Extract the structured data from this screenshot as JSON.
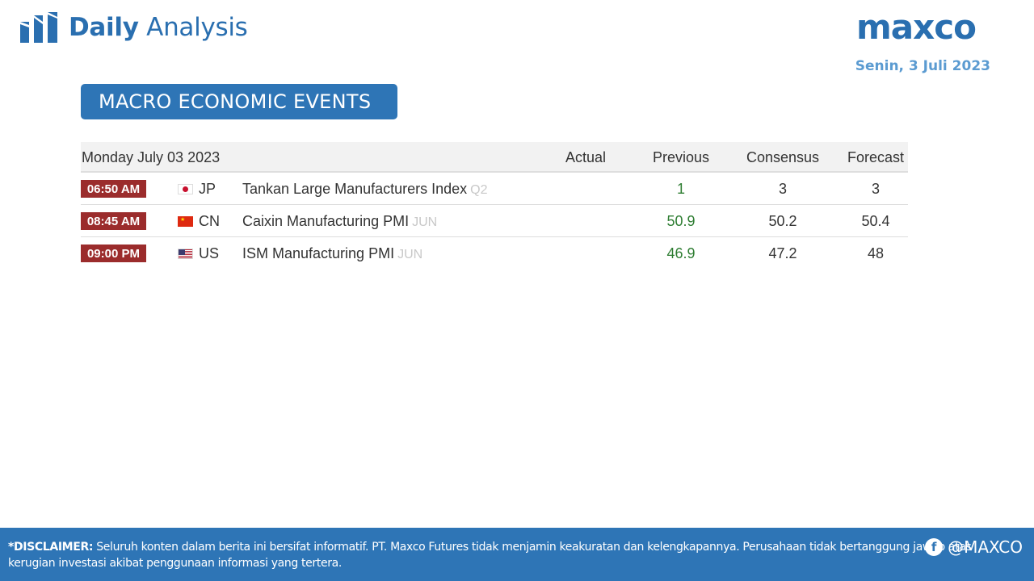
{
  "header": {
    "brand_bold": "Daily",
    "brand_light": " Analysis",
    "logo_text": "maxco",
    "date": "Senin, 3 Juli 2023"
  },
  "banner": {
    "title": "MACRO ECONOMIC EVENTS"
  },
  "table": {
    "columns": {
      "date": "Monday July 03 2023",
      "actual": "Actual",
      "previous": "Previous",
      "consensus": "Consensus",
      "forecast": "Forecast"
    },
    "rows": [
      {
        "time": "06:50 AM",
        "flag": "japan-flag-icon",
        "country": "JP",
        "event": "Tankan Large Manufacturers Index",
        "period": "Q2",
        "actual": "",
        "previous": "1",
        "consensus": "3",
        "forecast": "3"
      },
      {
        "time": "08:45 AM",
        "flag": "china-flag-icon",
        "country": "CN",
        "event": "Caixin Manufacturing PMI",
        "period": "JUN",
        "actual": "",
        "previous": "50.9",
        "consensus": "50.2",
        "forecast": "50.4"
      },
      {
        "time": "09:00 PM",
        "flag": "us-flag-icon",
        "country": "US",
        "event": "ISM Manufacturing PMI",
        "period": "JUN",
        "actual": "",
        "previous": "46.9",
        "consensus": "47.2",
        "forecast": "48"
      }
    ]
  },
  "footer": {
    "disclaimer_label": "*DISCLAIMER:",
    "disclaimer_text": " Seluruh konten dalam berita ini bersifat informatif. PT. Maxco Futures tidak menjamin keakuratan dan kelengkapannya. Perusahaan tidak bertanggung jawab atas kerugian investasi akibat penggunaan informasi yang tertera.",
    "social_handle": "@MAXCO"
  },
  "colors": {
    "brand_blue": "#2e75b6",
    "time_badge": "#9b2c2c",
    "previous_value": "#2e7d32",
    "date_text": "#5b9bd1"
  }
}
